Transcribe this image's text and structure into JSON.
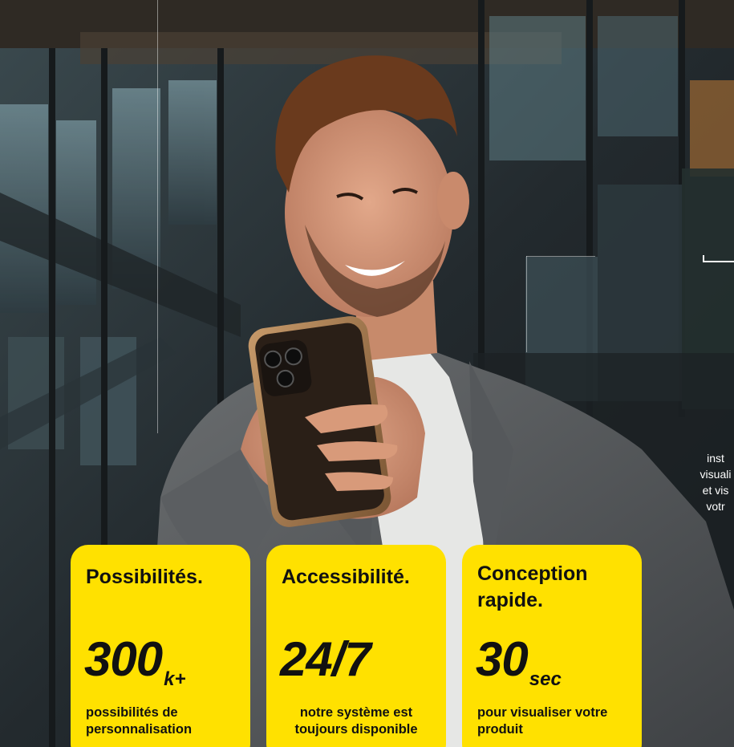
{
  "hero": {
    "background": "photo: smiling man in grey blazer looking at smartphone in front of glass office building",
    "accent_color": "#ffe100",
    "cut_off_text": [
      "inst",
      "visuali",
      "et vis",
      "votr"
    ]
  },
  "cards": [
    {
      "title": "Possibilités.",
      "stat_value": "300",
      "stat_unit": "k+",
      "description": "possibilités de personnalisation"
    },
    {
      "title": "Accessibilité.",
      "stat_value": "24/7",
      "stat_unit": "",
      "description": "notre système est toujours disponible"
    },
    {
      "title": "Conception rapide.",
      "stat_value": "30",
      "stat_unit": "sec",
      "description": "pour visualiser votre produit"
    }
  ]
}
